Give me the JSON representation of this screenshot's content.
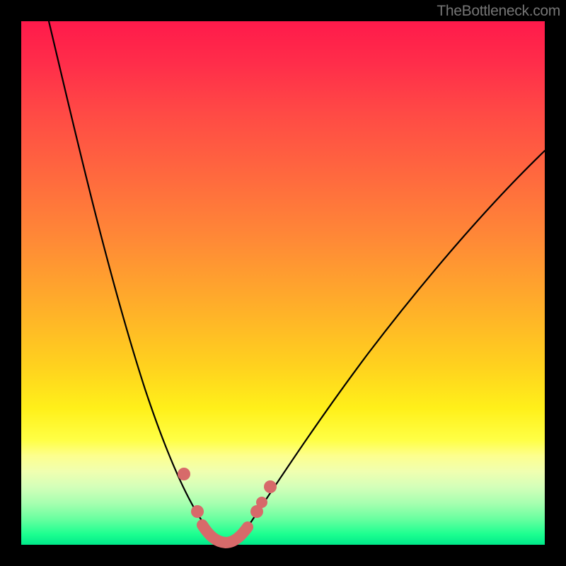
{
  "watermark": "TheBottleneck.com",
  "colors": {
    "frame": "#000000",
    "curve": "#000000",
    "markers": "#d76a6a"
  },
  "chart_data": {
    "type": "line",
    "title": "",
    "xlabel": "",
    "ylabel": "",
    "xlim": [
      0,
      100
    ],
    "ylim": [
      0,
      100
    ],
    "grid": false,
    "note": "Bottleneck-style V-curve. x is a normalized hardware balance index (0–100), y is bottleneck percentage (0–100). Minimum ≈ 0% around x ≈ 36–41. Values estimated from rendered curve.",
    "series": [
      {
        "name": "bottleneck_percent",
        "x": [
          0,
          4,
          8,
          12,
          16,
          20,
          24,
          28,
          30,
          32,
          34,
          36,
          38,
          40,
          42,
          44,
          48,
          52,
          56,
          60,
          64,
          68,
          72,
          76,
          80,
          84,
          88,
          92,
          96,
          100
        ],
        "y": [
          100,
          92,
          83,
          73,
          63,
          52,
          41,
          28,
          21,
          14,
          7,
          2,
          0,
          0,
          2,
          5,
          11,
          18,
          24,
          30,
          36,
          42,
          48,
          53,
          58,
          62,
          66,
          70,
          73,
          76
        ]
      }
    ],
    "markers": {
      "note": "Salmon dots/segment near curve minimum (estimated positions)",
      "points": [
        {
          "x": 31,
          "y": 13
        },
        {
          "x": 34,
          "y": 4
        },
        {
          "x": 36,
          "y": 1
        },
        {
          "x": 38,
          "y": 0
        },
        {
          "x": 40,
          "y": 0
        },
        {
          "x": 42,
          "y": 3
        },
        {
          "x": 44,
          "y": 5
        },
        {
          "x": 46,
          "y": 9
        }
      ]
    }
  }
}
